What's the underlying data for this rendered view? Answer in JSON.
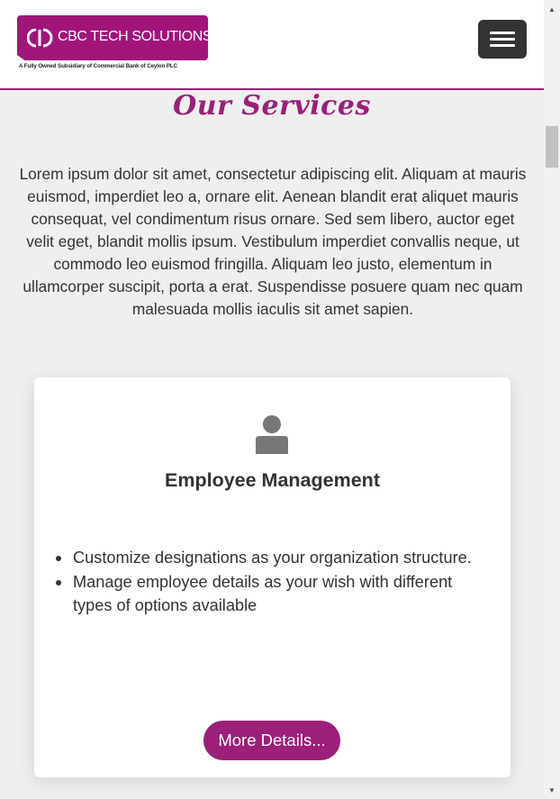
{
  "header": {
    "logo_name": "CBC TECH SOLUTIONS",
    "logo_tagline": "A Fully Owned Subsidiary of Commercial Bank of Ceylon PLC",
    "menu_icon": "hamburger-menu-icon"
  },
  "main": {
    "section_title": "Our Services",
    "intro": "Lorem ipsum dolor sit amet, consectetur adipiscing elit. Aliquam at mauris euismod, imperdiet leo a, ornare elit. Aenean blandit erat aliquet mauris consequat, vel condimentum risus ornare. Sed sem libero, auctor eget velit eget, blandit mollis ipsum. Vestibulum imperdiet convallis neque, ut commodo leo euismod fringilla. Aliquam leo justo, elementum in ullamcorper suscipit, porta a erat. Suspendisse posuere quam nec quam malesuada mollis iaculis sit amet sapien."
  },
  "card": {
    "icon": "user-icon",
    "title": "Employee Management",
    "features": [
      "Customize designations as your organization structure.",
      "Manage employee details as your wish with different types of options available"
    ],
    "button_label": "More Details..."
  },
  "colors": {
    "brand": "#9c1f79",
    "page_background": "#efefef",
    "card_background": "#ffffff",
    "menu_button": "#333333"
  }
}
